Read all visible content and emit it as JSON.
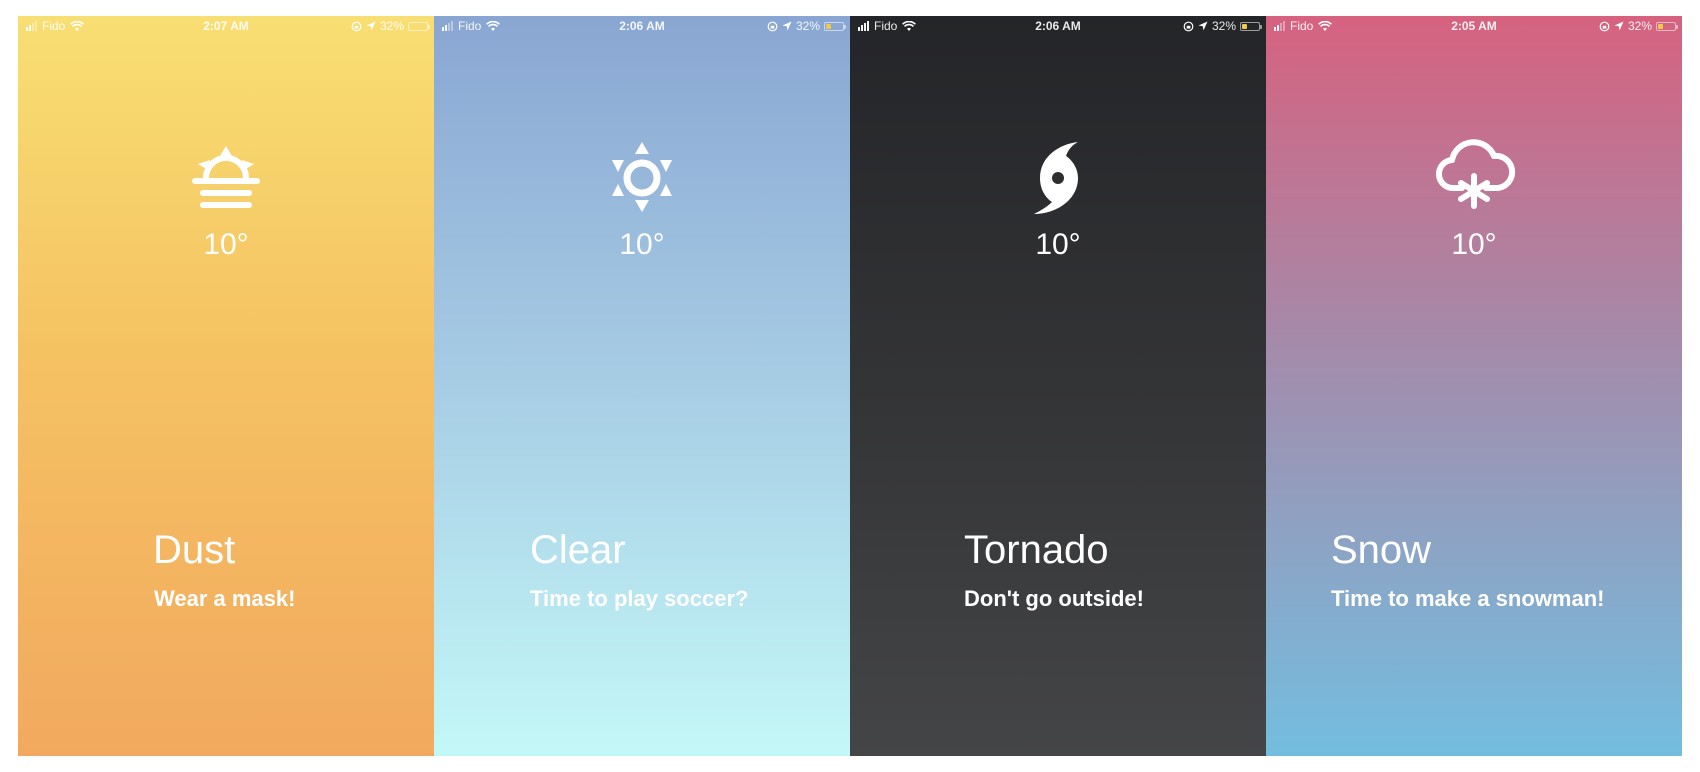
{
  "screens": [
    {
      "status": {
        "carrier": "Fido",
        "time": "2:07 AM",
        "battery": "32%"
      },
      "icon": "sunrise-fog-icon",
      "temperature": "10°",
      "condition": "Dust",
      "message": "Wear a mask!",
      "gradient": [
        "#F8DF73",
        "#F2A95F"
      ]
    },
    {
      "status": {
        "carrier": "Fido",
        "time": "2:06 AM",
        "battery": "32%"
      },
      "icon": "sun-icon",
      "temperature": "10°",
      "condition": "Clear",
      "message": "Time to play soccer?",
      "gradient": [
        "#89A6D2",
        "#C4F8F8"
      ]
    },
    {
      "status": {
        "carrier": "Fido",
        "time": "2:06 AM",
        "battery": "32%"
      },
      "icon": "hurricane-icon",
      "temperature": "10°",
      "condition": "Tornado",
      "message": "Don't go outside!",
      "gradient": [
        "#242528",
        "#444547"
      ]
    },
    {
      "status": {
        "carrier": "Fido",
        "time": "2:05 AM",
        "battery": "32%"
      },
      "icon": "snow-cloud-icon",
      "temperature": "10°",
      "condition": "Snow",
      "message": "Time to make a snowman!",
      "gradient": [
        "#D6627F",
        "#73BEE0"
      ]
    }
  ]
}
